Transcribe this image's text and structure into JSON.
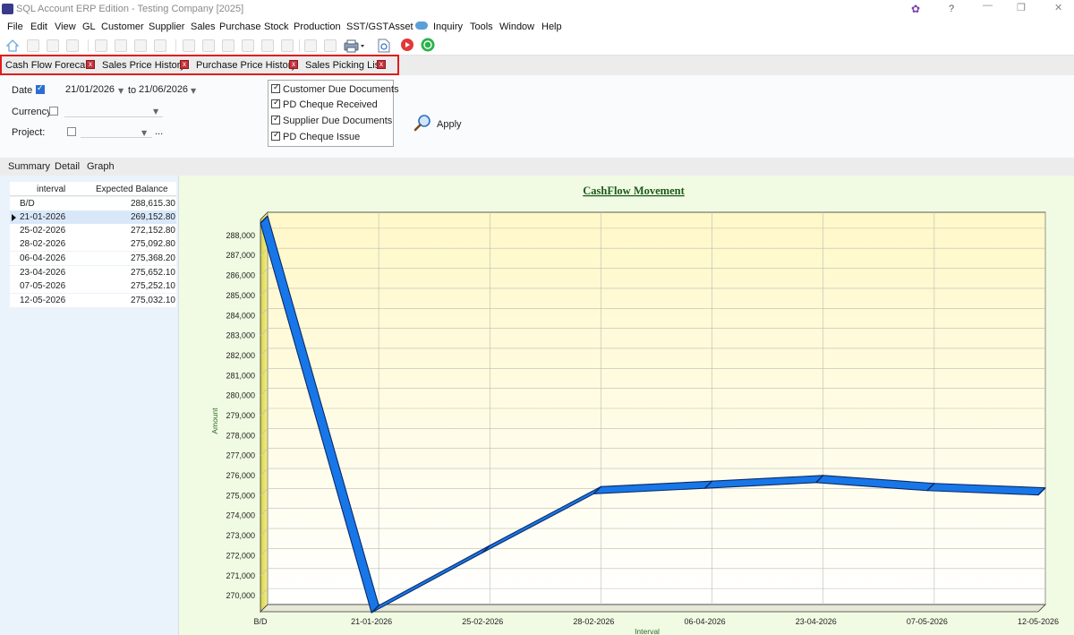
{
  "window": {
    "title": "SQL Account ERP Edition - Testing Company [2025]",
    "help": "?",
    "minimize": "—",
    "restore": "❐",
    "close": "✕"
  },
  "menu": [
    "File",
    "Edit",
    "View",
    "GL",
    "Customer",
    "Supplier",
    "Sales",
    "Purchase",
    "Stock",
    "Production",
    "SST/GST",
    "Asset",
    "Inquiry",
    "Tools",
    "Window",
    "Help"
  ],
  "doc_tabs": [
    {
      "label": "Cash Flow Forecast",
      "close": "x"
    },
    {
      "label": "Sales Price History",
      "close": "x"
    },
    {
      "label": "Purchase Price History",
      "close": "x"
    },
    {
      "label": "Sales Picking List",
      "close": "x"
    }
  ],
  "filter": {
    "date_label": "Date",
    "date_checked": true,
    "date_from": "21/01/2026",
    "date_to_label": "to",
    "date_to": "21/06/2026",
    "currency_label": "Currency",
    "currency_checked": false,
    "project_label": "Project:",
    "project_checked": false,
    "project_more": "...",
    "documents": [
      {
        "label": "Customer Due Documents",
        "checked": true
      },
      {
        "label": "PD Cheque Received",
        "checked": true
      },
      {
        "label": "Supplier Due Documents",
        "checked": true
      },
      {
        "label": "PD Cheque Issue",
        "checked": true
      }
    ],
    "apply_label": "Apply"
  },
  "view_tabs": [
    "Summary",
    "Detail",
    "Graph"
  ],
  "grid": {
    "headers": [
      "interval",
      "Expected Balance"
    ],
    "rows": [
      {
        "interval": "B/D",
        "balance": "288,615.30"
      },
      {
        "interval": "21-01-2026",
        "balance": "269,152.80",
        "selected": true
      },
      {
        "interval": "25-02-2026",
        "balance": "272,152.80"
      },
      {
        "interval": "28-02-2026",
        "balance": "275,092.80"
      },
      {
        "interval": "06-04-2026",
        "balance": "275,368.20"
      },
      {
        "interval": "23-04-2026",
        "balance": "275,652.10"
      },
      {
        "interval": "07-05-2026",
        "balance": "275,252.10"
      },
      {
        "interval": "12-05-2026",
        "balance": "275,032.10"
      }
    ]
  },
  "colors": {
    "line": "#1877e8",
    "line_edge": "#0b2a66",
    "plot_bg_top": "#fffbd0",
    "plot_bg_bottom": "#ffffff",
    "chart_panel": "#f1fbe3",
    "tab_frame": "#e21b1b"
  },
  "chart_data": {
    "type": "line",
    "title": "CashFlow Movement",
    "xlabel": "Interval",
    "ylabel": "Amount",
    "categories": [
      "B/D",
      "21-01-2026",
      "25-02-2026",
      "28-02-2026",
      "06-04-2026",
      "23-04-2026",
      "07-05-2026",
      "12-05-2026"
    ],
    "series": [
      {
        "values": [
          288615.3,
          269152.8,
          272152.8,
          275092.8,
          275368.2,
          275652.1,
          275252.1,
          275032.1
        ]
      }
    ],
    "yticks": [
      "270,000",
      "271,000",
      "272,000",
      "273,000",
      "274,000",
      "275,000",
      "276,000",
      "277,000",
      "278,000",
      "279,000",
      "280,000",
      "281,000",
      "282,000",
      "283,000",
      "284,000",
      "285,000",
      "286,000",
      "287,000",
      "288,000"
    ],
    "ylim": [
      269200,
      288800
    ],
    "grid": true,
    "style": "3d-ribbon"
  }
}
